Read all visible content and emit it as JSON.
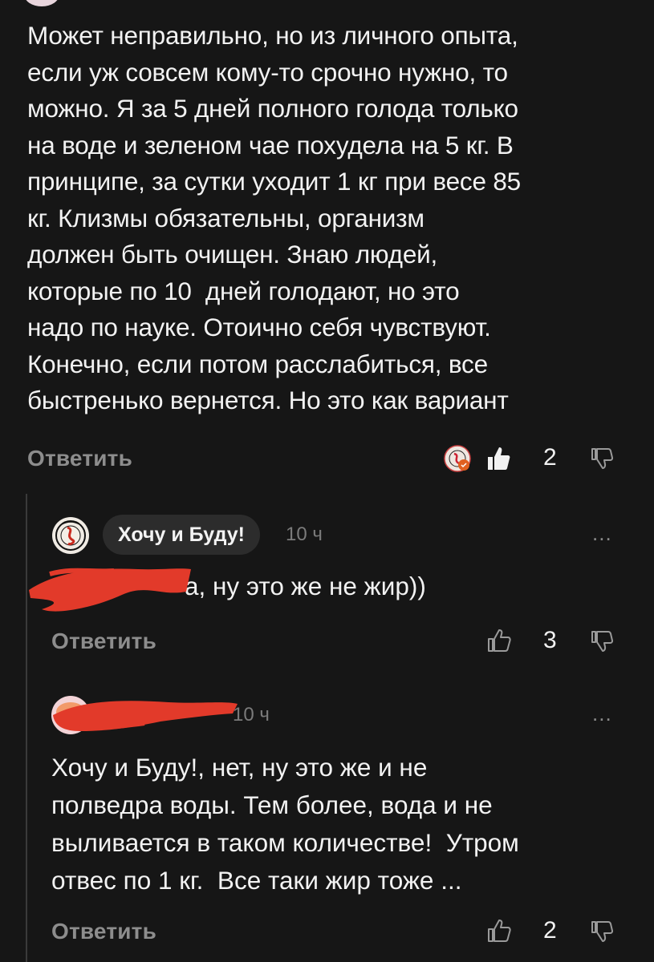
{
  "comment_main": {
    "text": "Может неправильно, но из личного опыта,\nесли уж совсем кому-то срочно нужно, то\nможно. Я за 5 дней полного голода только\nна воде и зеленом чае похудела на 5 кг. В\nпринципе, за сутки уходит 1 кг при весе 85\nкг. Клизмы обязательны, организм\nдолжен быть очищен. Знаю людей,\nкоторые по 10  дней голодают, но это\nнадо по науке. Отоично себя чувствуют.\nКонечно, если потом расслабиться, все\nбыстренько вернется. Но это как вариант",
    "reply_label": "Ответить",
    "like_count": "2"
  },
  "reply_1": {
    "author": "Хочу и Буду!",
    "time": "10 ч",
    "more": "...",
    "text": "а, ну это же не жир))",
    "reply_label": "Ответить",
    "like_count": "3"
  },
  "reply_2": {
    "time": "10 ч",
    "more": "...",
    "text": "Хочу и Буду!, нет, ну это же и не\nполведра воды. Тем более, вода и не\nвыливается в таком количестве!  Утром\nотвес по 1 кг.  Все таки жир тоже ...",
    "reply_label": "Ответить",
    "like_count": "2"
  },
  "colors": {
    "background": "#161616",
    "text": "#f2f2f2",
    "muted": "#8d8d8d",
    "author_pill": "#2c2c2c",
    "redaction": "#e23a2a"
  },
  "icons": [
    "avatar-icon",
    "thumbs-up-icon",
    "thumbs-down-icon",
    "more-icon"
  ]
}
